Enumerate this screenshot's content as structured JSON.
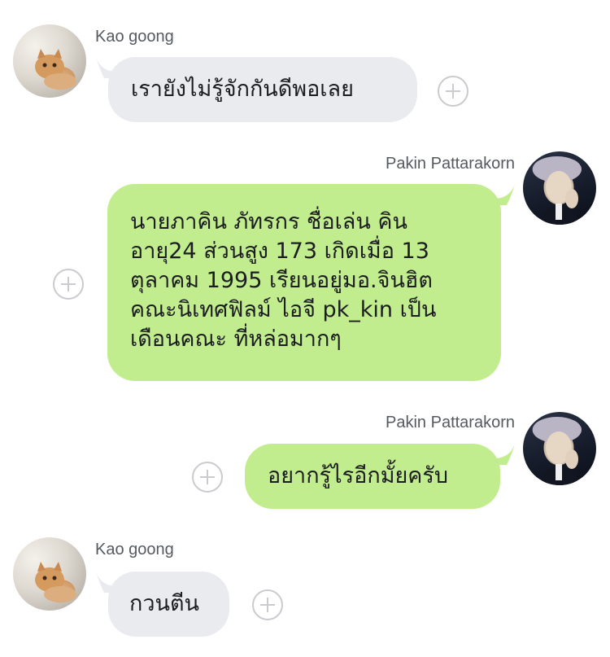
{
  "messages": [
    {
      "sender": "Kao goong",
      "side": "incoming",
      "lines": [
        "เรายังไม่รู้จักกันดีพอเลย"
      ]
    },
    {
      "sender": "Pakin Pattarakorn",
      "side": "outgoing",
      "lines": [
        "นายภาคิน ภัทรกร ชื่อเล่น คิน",
        "อายุ24 ส่วนสูง 173 เกิดเมื่อ 13",
        "ตุลาคม 1995 เรียนอยู่มอ.จินฮิต",
        "คณะนิเทศฟิลม์ ไอจี pk_kin เป็น",
        "เดือนคณะ ที่หล่อมากๆ"
      ]
    },
    {
      "sender": "Pakin Pattarakorn",
      "side": "outgoing",
      "lines": [
        "อยากรู้ไรอีกมั้ยครับ"
      ]
    },
    {
      "sender": "Kao goong",
      "side": "incoming",
      "lines": [
        "กวนตีน"
      ]
    }
  ],
  "colors": {
    "incoming_bubble": "#e9ebee",
    "outgoing_bubble": "#c2ed8e",
    "name_text": "#555a60",
    "message_text": "#1b1d21",
    "plus_icon": "#c9cbcf"
  },
  "icons": {
    "reaction": "plus-circle-icon",
    "incoming_avatar": "cat-photo-avatar",
    "outgoing_avatar": "person-photo-avatar"
  }
}
